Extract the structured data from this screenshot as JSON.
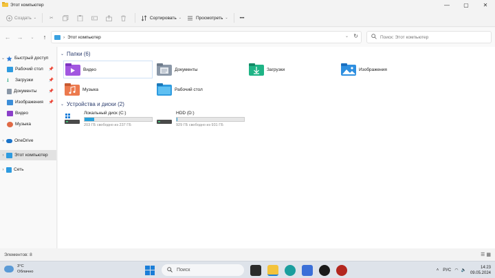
{
  "window": {
    "title": "Этот компьютер",
    "controls": [
      "—",
      "▢",
      "✕"
    ]
  },
  "toolbar": {
    "new_label": "Создать",
    "sort_label": "Сортировать",
    "view_label": "Просмотреть",
    "more_label": "•••"
  },
  "address": {
    "path": "Этот компьютер",
    "search_placeholder": "Поиск: Этот компьютер"
  },
  "sidebar": {
    "items": [
      {
        "label": "Быстрый доступ",
        "icon": "star-icon",
        "color": "#f2b01e"
      },
      {
        "label": "Рабочий стол",
        "icon": "desktop-icon",
        "color": "#2e9be0"
      },
      {
        "label": "Загрузки",
        "icon": "download-icon",
        "color": "#1aa37a"
      },
      {
        "label": "Документы",
        "icon": "documents-icon",
        "color": "#7a8796"
      },
      {
        "label": "Изображения",
        "icon": "pictures-icon",
        "color": "#3c8ed8"
      },
      {
        "label": "Видео",
        "icon": "video-icon",
        "color": "#8b3fc9"
      },
      {
        "label": "Музыка",
        "icon": "music-icon",
        "color": "#e06a45"
      },
      {
        "label": "OneDrive",
        "icon": "cloud-icon",
        "color": "#1a73c9"
      },
      {
        "label": "Этот компьютер",
        "icon": "pc-icon",
        "color": "#2e9be0"
      },
      {
        "label": "Сеть",
        "icon": "network-icon",
        "color": "#2e9be0"
      }
    ]
  },
  "content": {
    "folders_header": "Папки (6)",
    "folders": [
      {
        "label": "Видео",
        "icon": "video-folder-icon",
        "color": "#8b3fc9"
      },
      {
        "label": "Документы",
        "icon": "documents-folder-icon",
        "color": "#7a8796"
      },
      {
        "label": "Загрузки",
        "icon": "downloads-folder-icon",
        "color": "#1aa37a"
      },
      {
        "label": "Изображения",
        "icon": "pictures-folder-icon",
        "color": "#2e8fe0"
      },
      {
        "label": "Музыка",
        "icon": "music-folder-icon",
        "color": "#e06a45"
      },
      {
        "label": "Рабочий стол",
        "icon": "desktop-folder-icon",
        "color": "#2e9be0"
      }
    ],
    "drives_header": "Устройства и диски (2)",
    "drives": [
      {
        "label": "Локальный диск (C:)",
        "info": "203 ГБ свободно из 237 ГБ",
        "used_fraction": 0.14
      },
      {
        "label": "HDD (D:)",
        "info": "929 ГБ свободно из 931 ГБ",
        "used_fraction": 0.002
      }
    ]
  },
  "status": {
    "items_count": "Элементов: 8"
  },
  "taskbar": {
    "temperature": "3°C",
    "weather": "Облачно",
    "search_label": "Поиск",
    "language": "РУС",
    "time": "14:23",
    "date": "09.05.2024"
  }
}
